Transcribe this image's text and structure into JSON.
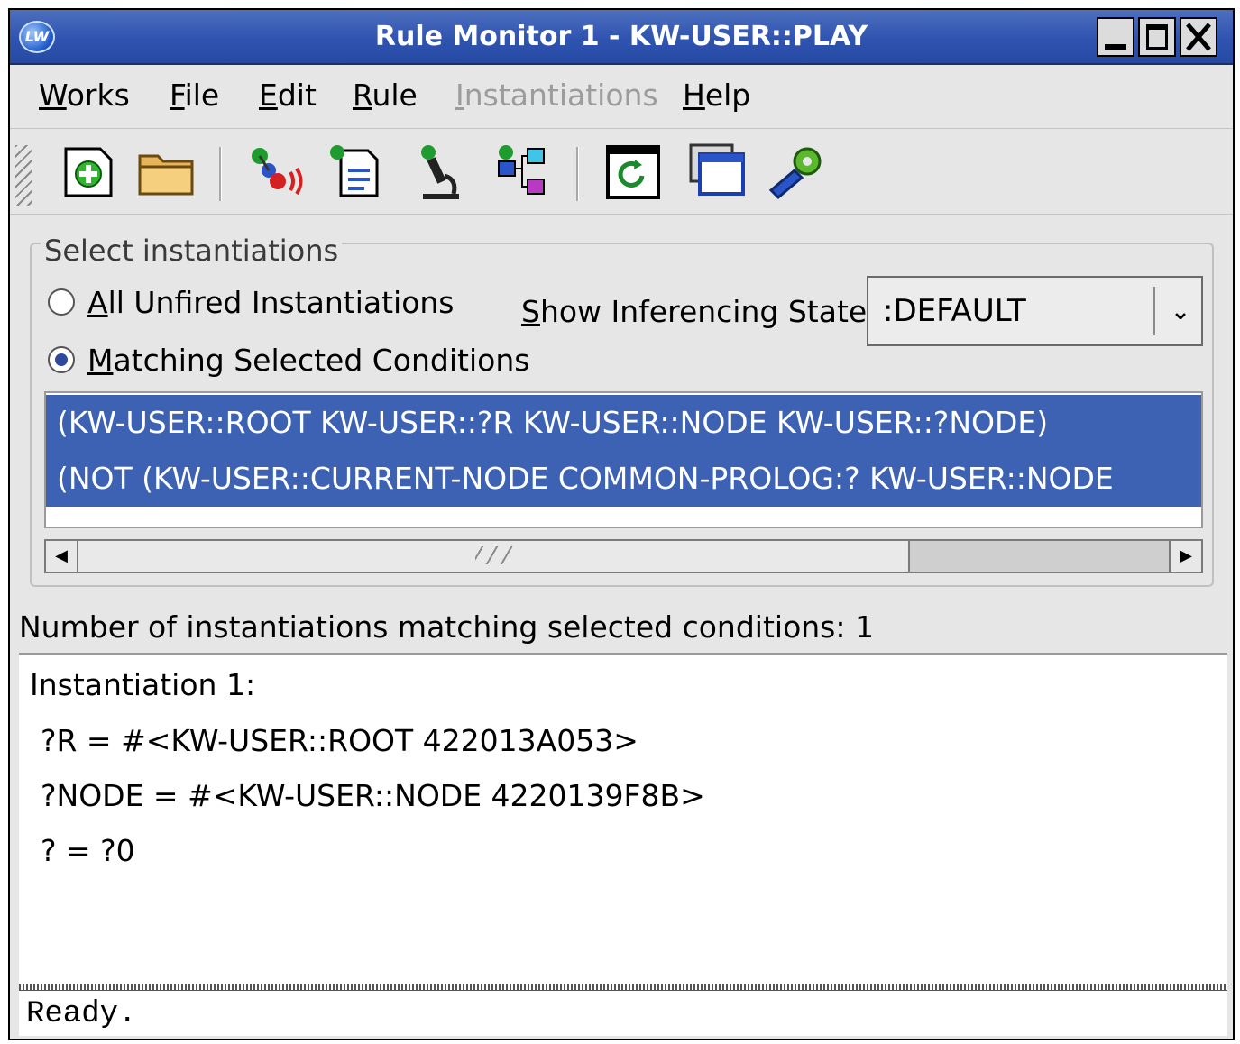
{
  "window": {
    "title": "Rule Monitor 1 - KW-USER::PLAY",
    "logo_text": "LW",
    "controls": [
      "minimize-icon",
      "maximize-icon",
      "close-icon"
    ]
  },
  "menu": [
    {
      "label": "Works",
      "underline": "W",
      "enabled": true
    },
    {
      "label": "File",
      "underline": "F",
      "enabled": true
    },
    {
      "label": "Edit",
      "underline": "E",
      "enabled": true
    },
    {
      "label": "Rule",
      "underline": "R",
      "enabled": true
    },
    {
      "label": "Instantiations",
      "underline": "I",
      "enabled": false
    },
    {
      "label": "Help",
      "underline": "H",
      "enabled": true
    }
  ],
  "toolbar": {
    "buttons": [
      "new-icon",
      "open-folder-icon",
      "rule-fire-icon",
      "rule-list-icon",
      "inspect-microscope-icon",
      "class-graph-icon",
      "refresh-window-icon",
      "window-icon",
      "tools-wrench-icon"
    ]
  },
  "select": {
    "legend": "Select instantiations",
    "radio_all": "All Unfired Instantiations",
    "radio_matching": "Matching Selected Conditions",
    "selected_radio": "matching",
    "state_label": "Show Inferencing State:",
    "state_value": ":DEFAULT"
  },
  "conditions": [
    "(KW-USER::ROOT KW-USER::?R KW-USER::NODE KW-USER::?NODE)",
    "(NOT (KW-USER::CURRENT-NODE COMMON-PROLOG:? KW-USER::NODE"
  ],
  "count_label": "Number of instantiations matching selected conditions: 1",
  "details": [
    "Instantiation 1:",
    "?R = #<KW-USER::ROOT 422013A053>",
    "?NODE = #<KW-USER::NODE 4220139F8B>",
    "? = ?0"
  ],
  "status": "Ready.",
  "colors": {
    "titlebar": "#2f54b0",
    "selection": "#3d62b3",
    "chrome": "#e6e6e6"
  }
}
